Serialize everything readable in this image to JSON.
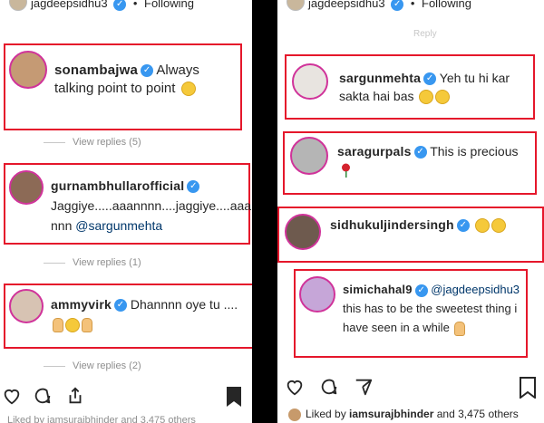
{
  "left": {
    "header": {
      "username": "jagdeepsidhu3",
      "separator": "•",
      "status": "Following"
    },
    "comments": [
      {
        "username": "sonambajwa",
        "text": "Always talking point to point",
        "emoji": "laughing-crying"
      },
      {
        "username": "gurnambhullarofficial",
        "text": "Jaggiye.....aaannnn....jaggiye....aaa nnn",
        "mention": "@sargunmehta"
      },
      {
        "username": "ammyvirk",
        "text": "Dhannnn oye tu ...."
      }
    ],
    "view_replies": [
      "View replies (5)",
      "View replies (1)",
      "View replies (2)"
    ],
    "liked_text": "Liked by iamsurajbhinder and 3,475 others"
  },
  "right": {
    "header": {
      "username": "jagdeepsidhu3",
      "separator": "•",
      "status": "Following"
    },
    "meta_text": "Reply",
    "comments": [
      {
        "username": "sargunmehta",
        "text": "Yeh tu hi kar sakta hai bas"
      },
      {
        "username": "saragurpals",
        "text": "This is precious"
      },
      {
        "username": "sidhukuljindersingh",
        "text": ""
      },
      {
        "username": "simichahal9",
        "mention": "@jagdeepsidhu3",
        "text": "this has to be the sweetest thing i have seen in a while"
      }
    ],
    "liked_by_prefix": "Liked by ",
    "liked_by_user": "iamsurajbhinder",
    "liked_by_suffix": " and 3,475 others"
  },
  "colors": {
    "highlight_border": "#e5172b",
    "verified": "#3897f0",
    "mention": "#00376b",
    "muted": "#8e8e8e"
  },
  "icons": [
    "heart-icon",
    "comment-icon",
    "share-icon",
    "bookmark-icon",
    "verified-badge-icon"
  ]
}
